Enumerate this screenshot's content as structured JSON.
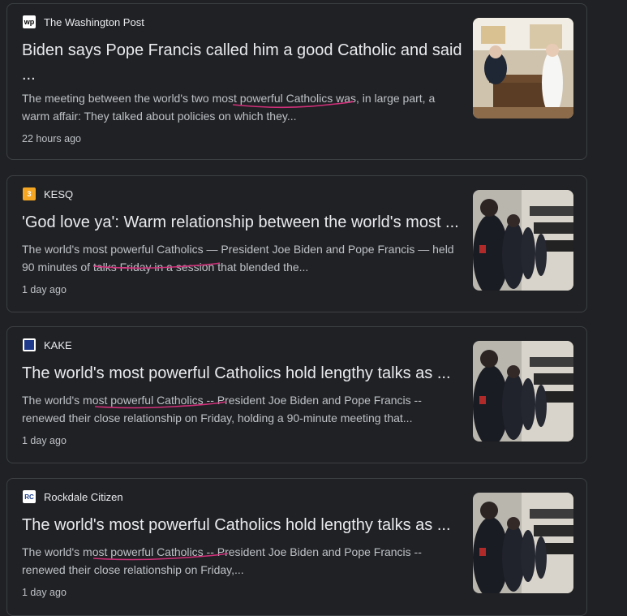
{
  "articles": [
    {
      "source": "The Washington Post",
      "logo_text": "wp",
      "headline": "Biden says Pope Francis called him a good Catholic and said ...",
      "snippet": "The meeting between the world's two most powerful Catholics was, in large part, a warm affair: They talked about policies on which they...",
      "time": "22 hours ago"
    },
    {
      "source": "KESQ",
      "logo_text": "3",
      "headline": "'God love ya': Warm relationship between the world's most ...",
      "snippet": "The world's most powerful Catholics — President Joe Biden and Pope Francis — held 90 minutes of talks Friday in a session that blended the...",
      "time": "1 day ago"
    },
    {
      "source": "KAKE",
      "logo_text": "",
      "headline": "The world's most powerful Catholics hold lengthy talks as ...",
      "snippet": "The world's most powerful Catholics -- President Joe Biden and Pope Francis -- renewed their close relationship on Friday, holding a 90-minute meeting that...",
      "time": "1 day ago"
    },
    {
      "source": "Rockdale Citizen",
      "logo_text": "RC",
      "headline": "The world's most powerful Catholics hold lengthy talks as ...",
      "snippet": "The world's most powerful Catholics -- President Joe Biden and Pope Francis -- renewed their close relationship on Friday,...",
      "time": "1 day ago"
    }
  ],
  "colors": {
    "background": "#202124",
    "border": "#3c4043",
    "headline": "#e8eaed",
    "snippet": "#bdc1c6",
    "annotation": "#d0307a"
  }
}
